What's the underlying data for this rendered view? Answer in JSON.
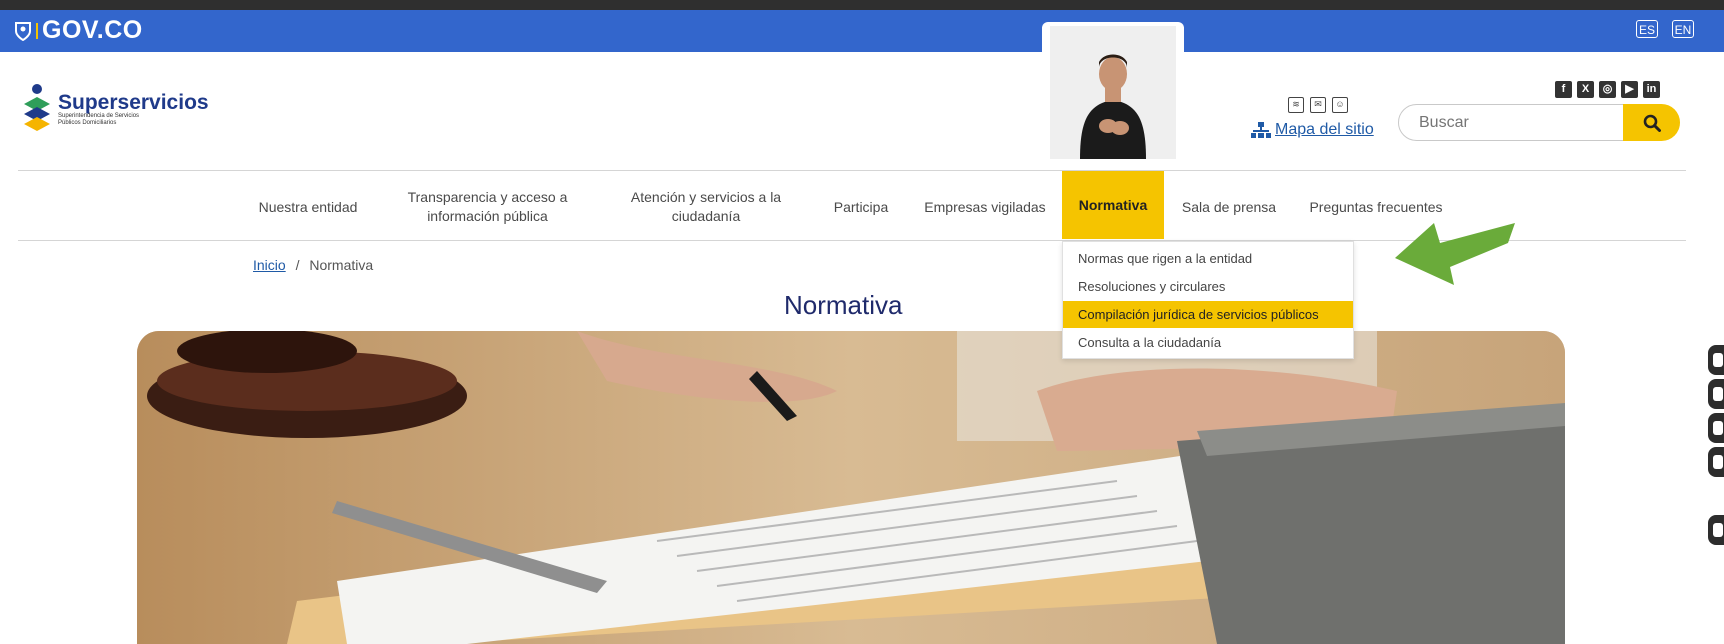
{
  "gov_bar": {
    "logo_text": "GOV.CO",
    "lang_es": "ES",
    "lang_en": "EN"
  },
  "header": {
    "brand_name": "Superservicios",
    "brand_sub_line1": "Superintendencia de Servicios",
    "brand_sub_line2": "Públicos Domiciliarios",
    "sitemap_label": "Mapa del sitio",
    "search_placeholder": "Buscar"
  },
  "nav": {
    "items": [
      "Nuestra entidad",
      "Transparencia y acceso a información pública",
      "Atención y servicios a la ciudadanía",
      "Participa",
      "Empresas vigiladas",
      "Normativa",
      "Sala de prensa",
      "Preguntas frecuentes"
    ]
  },
  "dropdown": {
    "items": [
      "Normas que rigen a la entidad",
      "Resoluciones y circulares",
      "Compilación jurídica de servicios públicos",
      "Consulta a la ciudadanía"
    ]
  },
  "breadcrumb": {
    "home": "Inicio",
    "separator": "/",
    "current": "Normativa"
  },
  "page": {
    "title": "Normativa"
  },
  "colors": {
    "gov_blue": "#3366cc",
    "accent_yellow": "#f5c400",
    "title_navy": "#1f2a6b",
    "arrow_green": "#6aab3a"
  },
  "icons": {
    "util": [
      "rss-icon",
      "mail-icon",
      "accessibility-icon"
    ],
    "social": [
      "facebook-icon",
      "x-icon",
      "instagram-icon",
      "youtube-icon",
      "linkedin-icon"
    ]
  }
}
